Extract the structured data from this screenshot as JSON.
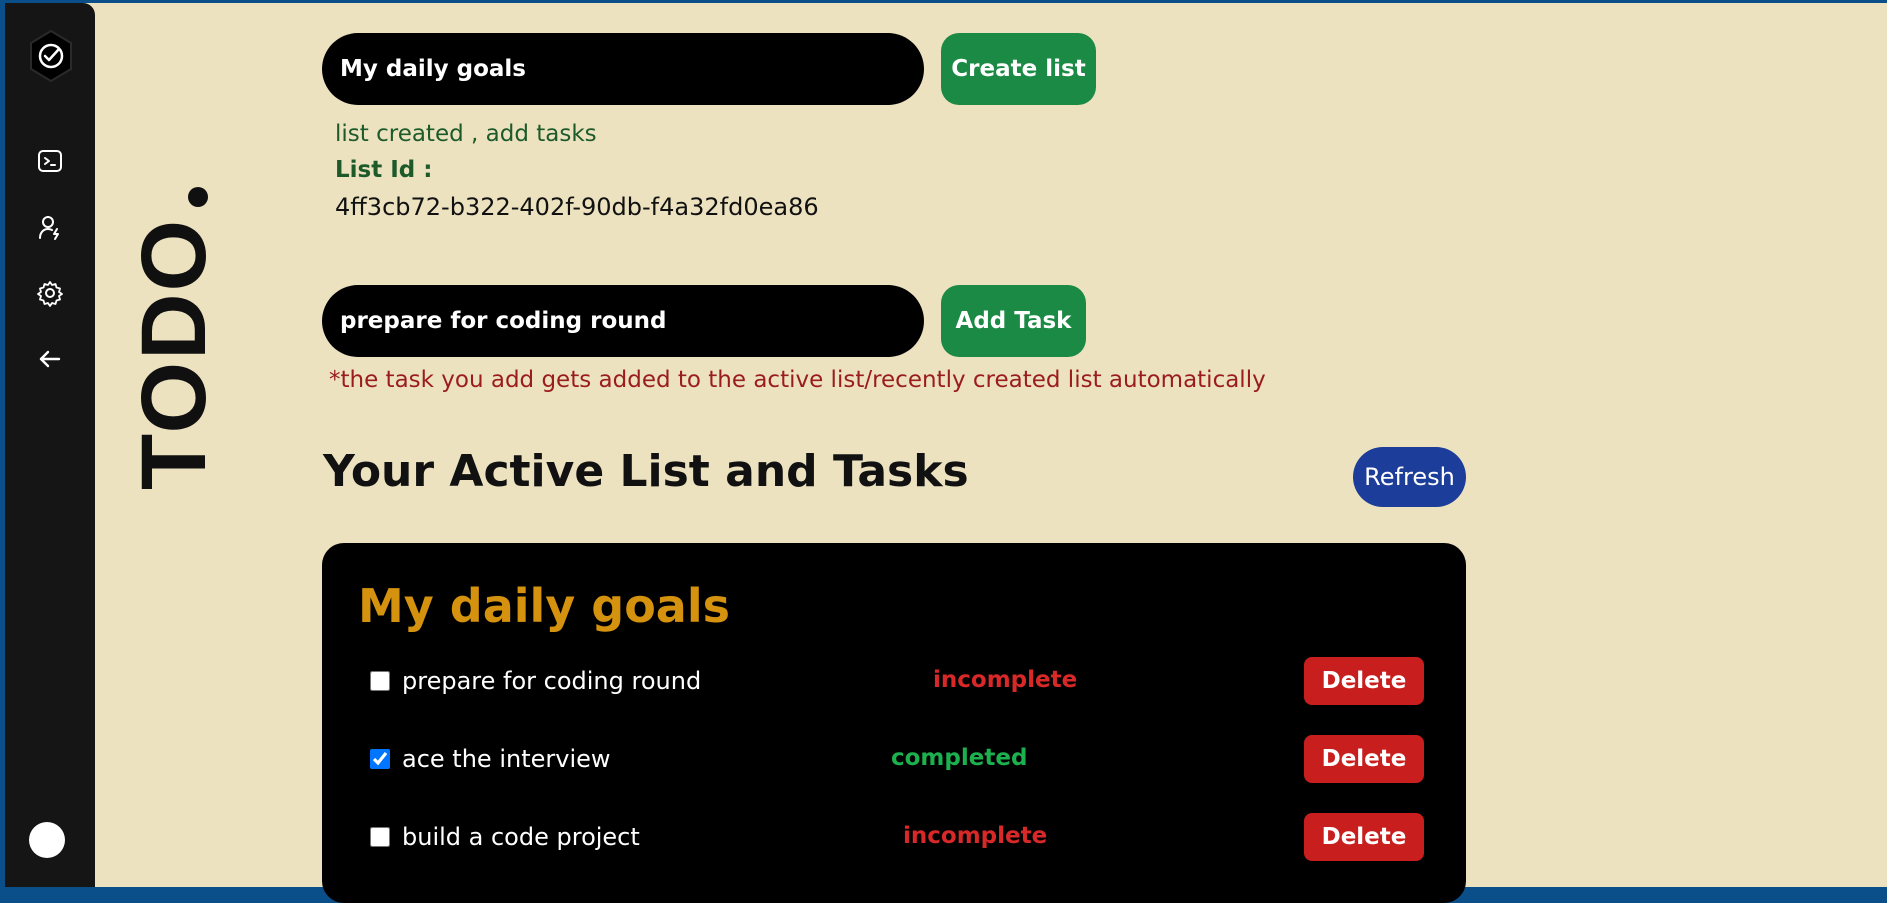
{
  "sidebar": {
    "items": [
      {
        "icon": "terminal-icon"
      },
      {
        "icon": "user-bolt-icon"
      },
      {
        "icon": "gear-icon"
      },
      {
        "icon": "arrow-left-icon"
      }
    ]
  },
  "brand": {
    "text": "TODO"
  },
  "create_list": {
    "input_value": "My daily goals",
    "button_label": "Create list",
    "status_message": "list created , add tasks",
    "list_id_label": "List Id :",
    "list_id_value": "4ff3cb72-b322-402f-90db-f4a32fd0ea86"
  },
  "add_task": {
    "input_value": "prepare for coding round",
    "button_label": "Add Task",
    "hint": "*the task you add gets added to the active list/recently created list automatically"
  },
  "active_section": {
    "title": "Your Active List and Tasks",
    "refresh_label": "Refresh"
  },
  "active_list": {
    "title": "My daily goals",
    "delete_label": "Delete",
    "tasks": [
      {
        "text": "prepare for coding round",
        "status": "incomplete",
        "checked": false
      },
      {
        "text": "ace the interview",
        "status": "completed",
        "checked": true
      },
      {
        "text": "build a code project",
        "status": "incomplete",
        "checked": false
      }
    ]
  },
  "colors": {
    "background": "#ece2c0",
    "sidebar": "#151515",
    "green_button": "#1b8a44",
    "refresh_button": "#1c3d99",
    "delete_button": "#c81e1e",
    "list_title": "#d4920e",
    "status_incomplete": "#d82828",
    "status_completed": "#1db04e"
  }
}
